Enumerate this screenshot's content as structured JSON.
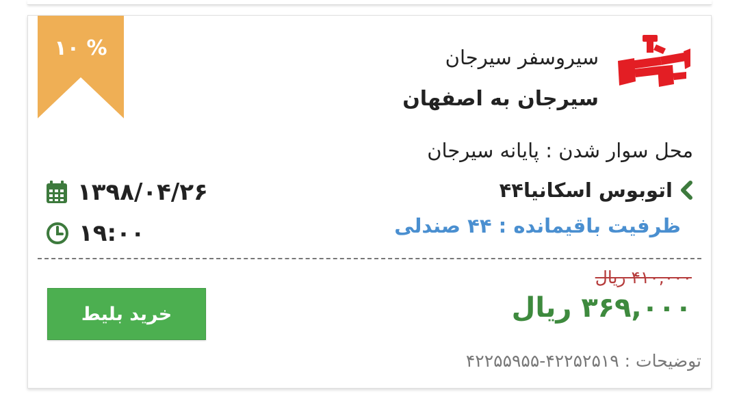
{
  "discount": {
    "label": "% ۱۰"
  },
  "company": {
    "name": "سیروسفر سیرجان",
    "route": "سیرجان به اصفهان",
    "logo_icon": "company-logo-icon"
  },
  "trip": {
    "boarding": "محل سوار شدن : پایانه سیرجان",
    "bus_type": "اتوبوس اسکانیا۴۴",
    "capacity": "ظرفیت باقیمانده : ۴۴ صندلی",
    "date": "۱۳۹۸/۰۴/۲۶",
    "time": "۱۹:۰۰"
  },
  "price": {
    "old": "۴۱۰,۰۰۰ ریال",
    "new": "۳۶۹,۰۰۰ ریال"
  },
  "actions": {
    "buy_label": "خرید بلیط"
  },
  "description": "توضیحات : ۴۲۲۵۲۵۱۹-۴۲۲۵۵۹۵۵",
  "colors": {
    "ribbon": "#efaf55",
    "buy_button": "#4caf50",
    "price_new": "#3e8a3e",
    "price_old": "#b53b3b",
    "capacity": "#4a8fd0",
    "icon_green": "#3d7a3d",
    "logo_red": "#e31e24"
  }
}
